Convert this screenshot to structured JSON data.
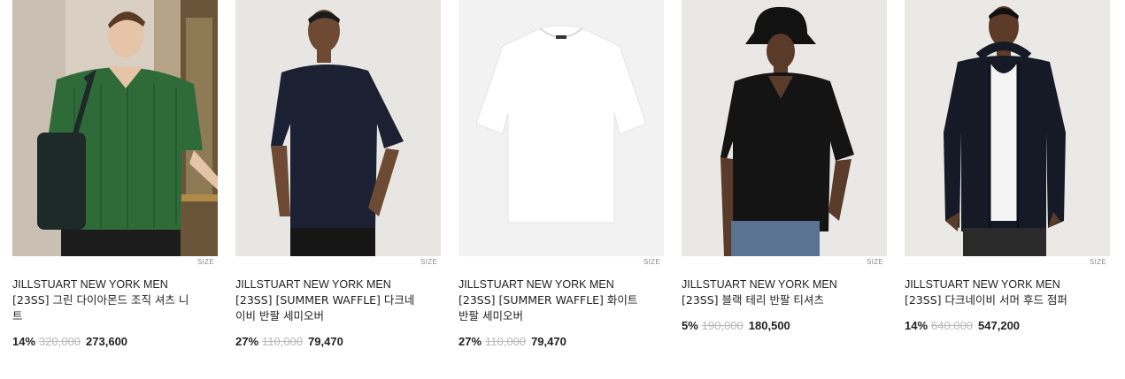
{
  "products": [
    {
      "brand": "JILLSTUART NEW YORK MEN",
      "name": "[23SS] 그린 다이아몬드 조직 셔츠 니트",
      "discount": "14%",
      "original_price": "320,000",
      "sale_price": "273,600",
      "size_tag": "SIZE",
      "image_icon": "green-knit-shirt-photo"
    },
    {
      "brand": "JILLSTUART NEW YORK MEN",
      "name": "[23SS] [SUMMER WAFFLE] 다크네이비 반팔 세미오버",
      "discount": "27%",
      "original_price": "110,000",
      "sale_price": "79,470",
      "size_tag": "SIZE",
      "image_icon": "navy-tshirt-photo"
    },
    {
      "brand": "JILLSTUART NEW YORK MEN",
      "name": "[23SS] [SUMMER WAFFLE] 화이트 반팔 세미오버",
      "discount": "27%",
      "original_price": "110,000",
      "sale_price": "79,470",
      "size_tag": "SIZE",
      "image_icon": "white-tshirt-photo"
    },
    {
      "brand": "JILLSTUART NEW YORK MEN",
      "name": "[23SS] 블랙 테리 반팔 티셔츠",
      "discount": "5%",
      "original_price": "190,000",
      "sale_price": "180,500",
      "size_tag": "SIZE",
      "image_icon": "black-terry-tshirt-photo"
    },
    {
      "brand": "JILLSTUART NEW YORK MEN",
      "name": "[23SS] 다크네이비 서머 후드 점퍼",
      "discount": "14%",
      "original_price": "640,000",
      "sale_price": "547,200",
      "size_tag": "SIZE",
      "image_icon": "navy-hood-jumper-photo"
    }
  ]
}
